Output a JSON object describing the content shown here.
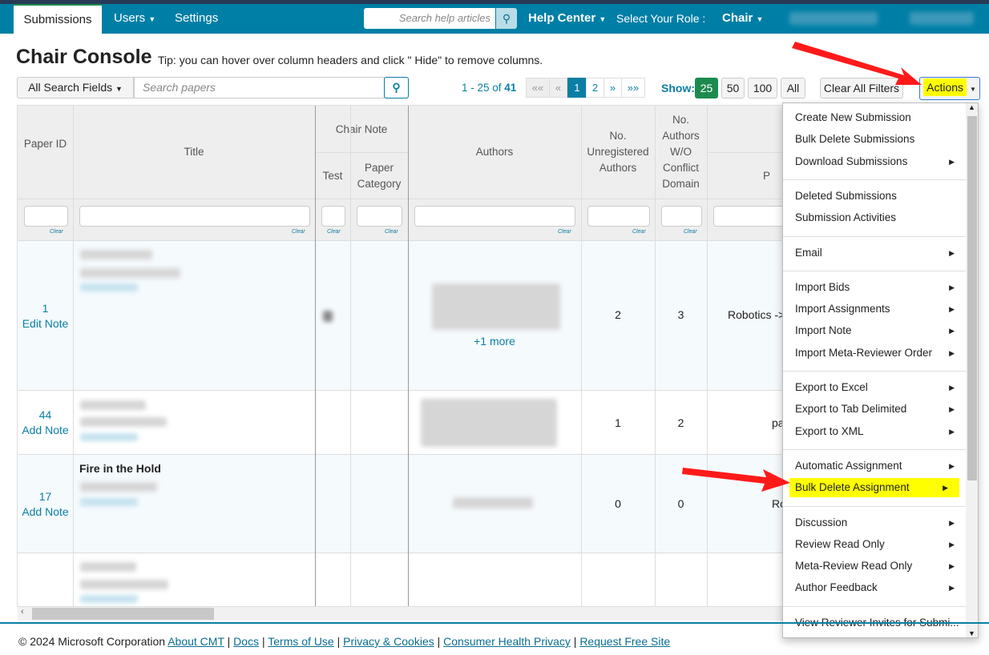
{
  "nav": {
    "tabs": [
      "Submissions",
      "Users",
      "Settings"
    ],
    "help_search_placeholder": "Search help articles",
    "help_center": "Help Center",
    "role_label": "Select Your Role :",
    "role": "Chair"
  },
  "page": {
    "title": "Chair Console",
    "tip": "Tip: you can hover over column headers and click \" Hide\" to remove columns."
  },
  "toolbar": {
    "search_field": "All Search Fields",
    "search_placeholder": "Search papers",
    "range": "1 - 25 of",
    "total": "41",
    "pages": [
      "««",
      "«",
      "1",
      "2",
      "»",
      "»»"
    ],
    "show_label": "Show:",
    "show_options": [
      "25",
      "50",
      "100",
      "All"
    ],
    "clear_filters": "Clear All Filters",
    "actions": "Actions"
  },
  "table": {
    "headers": {
      "paper_id": "Paper ID",
      "title": "Title",
      "chair_note": "Chair Note",
      "test": "Test",
      "paper_category": "Paper Category",
      "authors": "Authors",
      "unregistered": "No. Unregistered Authors",
      "wo_conflict": "No. Authors W/O Conflict Domain",
      "primary": "P"
    },
    "clear": "Clear",
    "rows": [
      {
        "id": "1",
        "note": "Edit Note",
        "more": "+1 more",
        "unreg": "2",
        "woc": "3",
        "primary": "Robotics ->"
      },
      {
        "id": "44",
        "note": "Add Note",
        "unreg": "1",
        "woc": "2",
        "primary": "pa"
      },
      {
        "id": "17",
        "note": "Add Note",
        "title": "Fire in the Hold",
        "unreg": "0",
        "woc": "0",
        "primary": "Ro"
      },
      {
        "id": "",
        "note": ""
      }
    ]
  },
  "menu": {
    "items": [
      {
        "label": "Create New Submission",
        "sub": false
      },
      {
        "label": "Bulk Delete Submissions",
        "sub": false
      },
      {
        "label": "Download Submissions",
        "sub": true
      },
      {
        "label": "Deleted Submissions",
        "sub": false
      },
      {
        "label": "Submission Activities",
        "sub": false
      },
      {
        "label": "Email",
        "sub": true
      },
      {
        "label": "Import Bids",
        "sub": true
      },
      {
        "label": "Import Assignments",
        "sub": true
      },
      {
        "label": "Import Note",
        "sub": true
      },
      {
        "label": "Import Meta-Reviewer Order",
        "sub": true
      },
      {
        "label": "Export to Excel",
        "sub": true
      },
      {
        "label": "Export to Tab Delimited",
        "sub": true
      },
      {
        "label": "Export to XML",
        "sub": true
      },
      {
        "label": "Automatic Assignment",
        "sub": true
      },
      {
        "label": "Bulk Delete Assignment",
        "sub": true,
        "highlight": true
      },
      {
        "label": "Discussion",
        "sub": true
      },
      {
        "label": "Review Read Only",
        "sub": true
      },
      {
        "label": "Meta-Review Read Only",
        "sub": true
      },
      {
        "label": "Author Feedback",
        "sub": true
      },
      {
        "label": "View Reviewer Invites for Submi...",
        "sub": false
      }
    ]
  },
  "footer": {
    "copyright": "© 2024 Microsoft Corporation",
    "links": [
      "About CMT",
      "Docs",
      "Terms of Use",
      "Privacy & Cookies",
      "Consumer Health Privacy",
      "Request Free Site"
    ]
  },
  "colors": {
    "nav": "#007fa6",
    "accent": "#0a7ea4",
    "show_active": "#1c8a4e",
    "highlight": "#ffff00",
    "arrow": "#ff0000"
  }
}
